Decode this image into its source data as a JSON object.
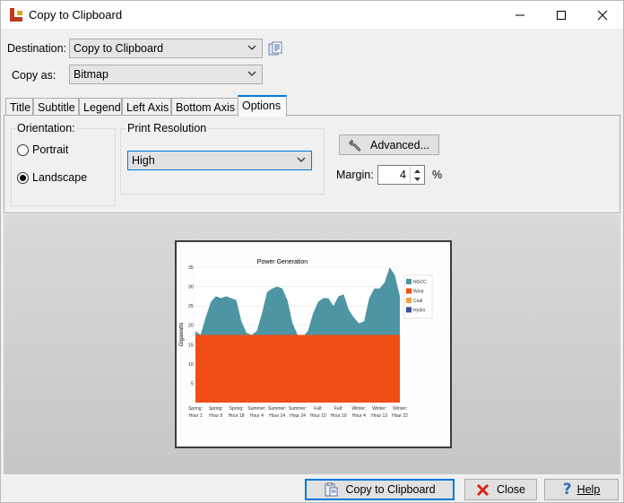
{
  "window": {
    "title": "Copy to Clipboard"
  },
  "destination": {
    "label": "Destination:",
    "value": "Copy to Clipboard"
  },
  "copy_as": {
    "label": "Copy as:",
    "value": "Bitmap"
  },
  "tabs": [
    {
      "label": "Title"
    },
    {
      "label": "Subtitle"
    },
    {
      "label": "Legend"
    },
    {
      "label": "Left Axis"
    },
    {
      "label": "Bottom Axis"
    },
    {
      "label": "Options",
      "active": true
    }
  ],
  "options": {
    "orientation": {
      "label": "Orientation:",
      "portrait": "Portrait",
      "landscape": "Landscape",
      "selected": "Landscape"
    },
    "print_resolution": {
      "label": "Print Resolution",
      "value": "High"
    },
    "advanced_label": "Advanced...",
    "margin": {
      "label": "Margin:",
      "value": "4",
      "unit": "%"
    }
  },
  "buttons": {
    "copy": "Copy to Clipboard",
    "close": "Close",
    "help": "Help"
  },
  "colors": {
    "tab_accent": "#0078d7",
    "close_x": "#d9261c",
    "help_q": "#2f6fb5",
    "ngcc": "#4e95a4",
    "wind": "#f04e14",
    "coal": "#f1a23c",
    "hydro": "#3a4fa0"
  },
  "chart_data": {
    "type": "area",
    "title": "Power Generation",
    "ylabel": "Gigawatts",
    "xlabel": "",
    "ylim": [
      0,
      35
    ],
    "yticks": [
      5,
      10,
      15,
      20,
      25,
      30,
      35
    ],
    "xticks": [
      [
        "Spring:",
        "Hour 1"
      ],
      [
        "Spring:",
        "Hour 9"
      ],
      [
        "Spring:",
        "Hour 18"
      ],
      [
        "Summer:",
        "Hour 4"
      ],
      [
        "Summer:",
        "Hour 14"
      ],
      [
        "Summer:",
        "Hour 24"
      ],
      [
        "Fall:",
        "Hour 10"
      ],
      [
        "Fall:",
        "Hour 19"
      ],
      [
        "Winter:",
        "Hour 4"
      ],
      [
        "Winter:",
        "Hour 13"
      ],
      [
        "Winter:",
        "Hour 22"
      ]
    ],
    "legend": [
      "NGCC",
      "Wind",
      "Coal",
      "Hydro"
    ],
    "legend_position": "right",
    "series": [
      {
        "name": "Wind",
        "values": [
          17.5
        ]
      },
      {
        "name": "NGCC",
        "values": [
          18.5,
          17.5,
          22,
          26,
          27.5,
          27,
          27.5,
          27,
          26.5,
          21,
          18,
          17.5,
          18.5,
          23,
          28.5,
          29.5,
          30,
          29.5,
          26.5,
          20.5,
          17.5,
          17,
          18.5,
          23,
          26,
          27,
          27,
          25,
          27.5,
          28,
          24,
          22,
          20.5,
          21,
          27,
          29.5,
          29.5,
          31,
          35,
          33,
          27.5
        ]
      }
    ]
  }
}
